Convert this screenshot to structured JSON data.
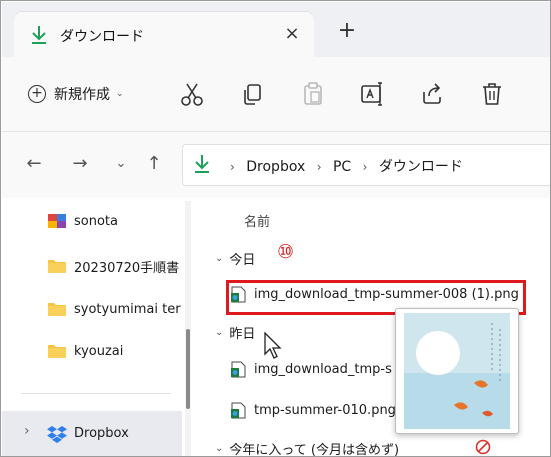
{
  "tab": {
    "title": "ダウンロード",
    "close_glyph": "×",
    "newtab_glyph": "+"
  },
  "toolbar": {
    "new_label": "新規作成",
    "new_chevron": "⌄",
    "buttons": [
      "cut-icon",
      "copy-icon",
      "paste-icon",
      "rename-icon",
      "share-icon",
      "delete-icon"
    ]
  },
  "nav": {
    "back": "←",
    "forward": "→",
    "recent": "⌄",
    "up": "↑",
    "breadcrumb": [
      "Dropbox",
      "PC",
      "ダウンロード"
    ],
    "separator": "›"
  },
  "sidebar": {
    "items": [
      {
        "label": "sonota",
        "icon": "colorful-folder-icon"
      },
      {
        "label": "20230720手順書",
        "icon": "folder-icon"
      },
      {
        "label": "syotyumimai ter",
        "icon": "folder-icon"
      },
      {
        "label": "kyouzai",
        "icon": "folder-icon"
      }
    ],
    "dropbox": {
      "label": "Dropbox",
      "chevron": "›"
    }
  },
  "content": {
    "column_header": "名前",
    "groups": [
      {
        "label": "今日",
        "files": [
          "img_download_tmp-summer-008 (1).png"
        ]
      },
      {
        "label": "昨日",
        "files": [
          "img_download_tmp-s",
          "tmp-summer-010.png"
        ]
      },
      {
        "label": "今年に入って (今月は含めず)",
        "files": []
      }
    ],
    "group_chevron": "⌄"
  },
  "annotation": {
    "number": "⑩"
  },
  "colors": {
    "accent_green": "#1aa15a",
    "selection": "#cfe1f7",
    "highlight_red": "#e0191f",
    "folder_yellow": "#f4c542"
  }
}
